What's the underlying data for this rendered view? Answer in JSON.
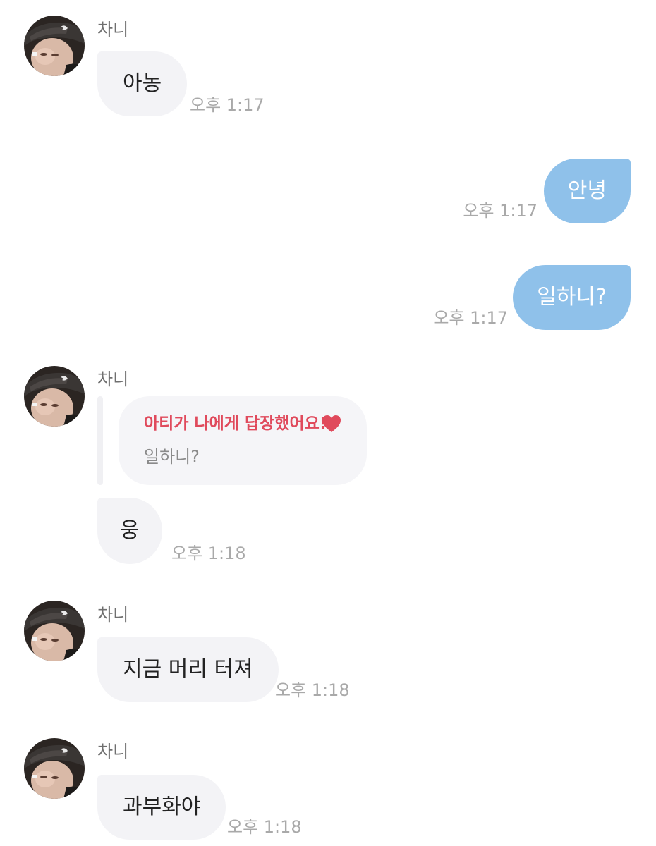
{
  "chat": {
    "sender_name": "차니",
    "messages": [
      {
        "text": "아농",
        "time": "오후 1:17"
      },
      {
        "text": "안녕",
        "time": "오후 1:17"
      },
      {
        "text": "일하니?",
        "time": "오후 1:17"
      },
      {
        "reply_title": "아티가 나에게 답장했어요!",
        "reply_quote": "일하니?",
        "reply_icon": "heart-icon"
      },
      {
        "text": "웅",
        "time": "오후 1:18"
      },
      {
        "text": "지금 머리 터져",
        "time": "오후 1:18"
      },
      {
        "text": "과부화야",
        "time": "오후 1:18"
      }
    ],
    "colors": {
      "incoming_bubble": "#f3f3f6",
      "outgoing_bubble": "#8fc1ea",
      "reply_accent": "#e04a5c",
      "timestamp": "#a9a9a9"
    }
  }
}
